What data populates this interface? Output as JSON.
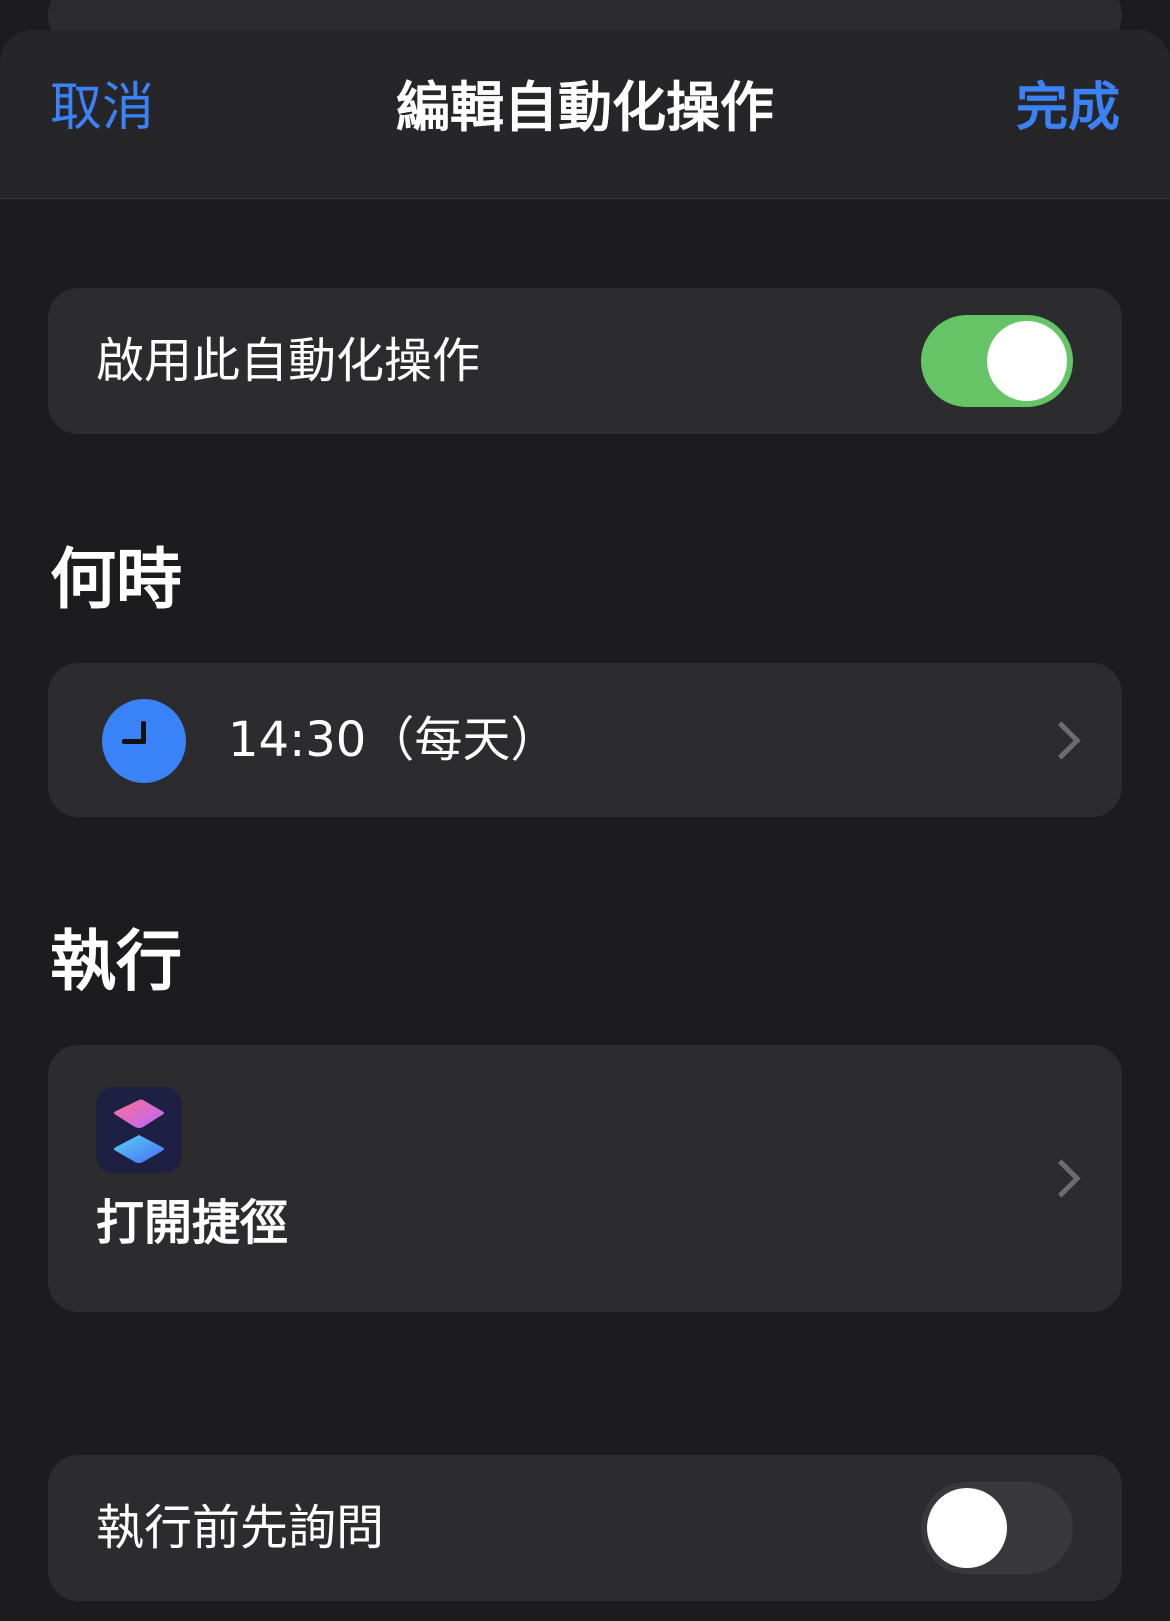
{
  "nav": {
    "cancel_label": "取消",
    "title": "編輯自動化操作",
    "done_label": "完成"
  },
  "enable_row": {
    "label": "啟用此自動化操作",
    "toggle_on": true
  },
  "when_section": {
    "header": "何時",
    "trigger_label": "14:30（每天）",
    "icon": "clock-icon"
  },
  "do_section": {
    "header": "執行",
    "action_label": "打開捷徑",
    "icon": "shortcuts-icon"
  },
  "ask_row": {
    "label": "執行前先詢問",
    "toggle_on": false
  },
  "colors": {
    "accent": "#3b82f6",
    "toggle_on": "#65c466",
    "background": "#1c1c1e",
    "card": "#2c2c2e"
  }
}
